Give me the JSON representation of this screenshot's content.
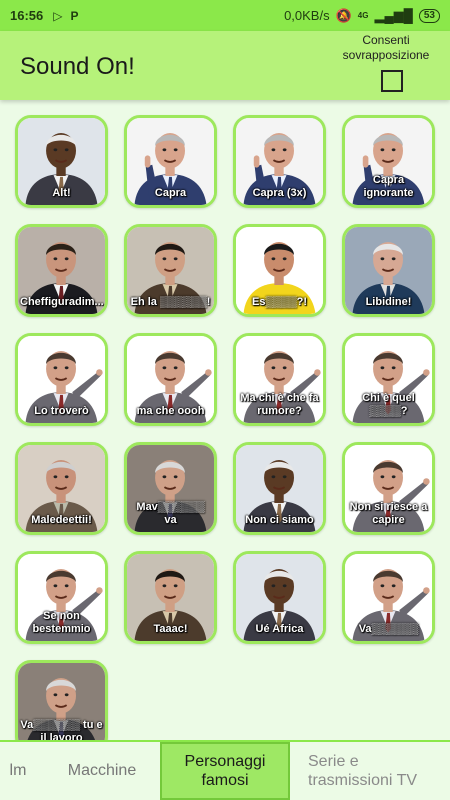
{
  "status_bar": {
    "time": "16:56",
    "speed": "0,0KB/s",
    "network": "4G",
    "battery": "53",
    "icons": [
      "play-store-icon",
      "p-icon",
      "alarm-off-icon",
      "signal-icon",
      "battery-icon"
    ]
  },
  "app": {
    "title": "Sound On!",
    "overlay_label": "Consenti sovrapposizione",
    "overlay_checked": false,
    "accent": "#8be84a",
    "bar_color": "#b6f27a",
    "tile_border": "#9de85c"
  },
  "sounds": [
    {
      "label": "Alt!",
      "art": "black"
    },
    {
      "label": "Capra",
      "art": "sgarbi"
    },
    {
      "label": "Capra (3x)",
      "art": "sgarbi"
    },
    {
      "label": "Capra ignorante",
      "art": "sgarbi"
    },
    {
      "label": "Cheffiguradim...",
      "art": "dark-suit"
    },
    {
      "label": "Eh la ▒▒▒▒▒▒!",
      "art": "young"
    },
    {
      "label": "Es▒▒▒▒?!",
      "art": "yellow"
    },
    {
      "label": "Libidine!",
      "art": "grey-hair"
    },
    {
      "label": "Lo troverò",
      "art": "pointing"
    },
    {
      "label": "ma che oooh",
      "art": "pointing"
    },
    {
      "label": "Ma chi è che fa rumore?",
      "art": "pointing"
    },
    {
      "label": "Chi è quel ▒▒▒▒?",
      "art": "pointing"
    },
    {
      "label": "Maledeettii!",
      "art": "shouting"
    },
    {
      "label": "Mav▒▒▒▒▒▒ va",
      "art": "old"
    },
    {
      "label": "Non ci siamo",
      "art": "black"
    },
    {
      "label": "Non si riesce a capire",
      "art": "pointing"
    },
    {
      "label": "Se non bestemmio",
      "art": "pointing"
    },
    {
      "label": "Taaac!",
      "art": "young"
    },
    {
      "label": "Ué Africa",
      "art": "black"
    },
    {
      "label": "Va▒▒▒▒▒▒",
      "art": "pointing"
    },
    {
      "label": "Va▒▒▒▒▒▒ tu e il lavoro",
      "art": "old"
    }
  ],
  "tabs": [
    {
      "label": "lm",
      "active": false
    },
    {
      "label": "Macchine",
      "active": false
    },
    {
      "label": "Personaggi famosi",
      "active": true
    },
    {
      "label": "Serie e trasmissioni TV",
      "active": false
    }
  ]
}
